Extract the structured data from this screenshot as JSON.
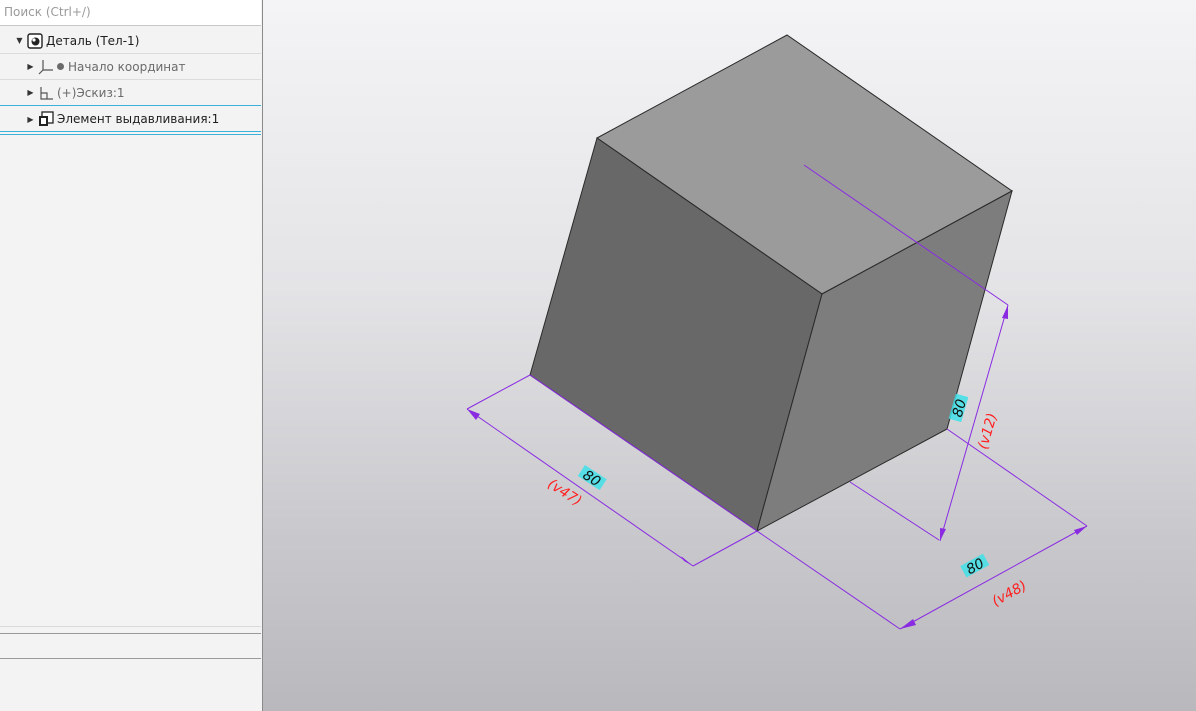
{
  "search": {
    "placeholder": "Поиск (Ctrl+/)"
  },
  "tree": {
    "root": {
      "label": "Деталь (Тел-1)"
    },
    "origin": {
      "label": "Начало координат"
    },
    "sketch": {
      "label": "(+)Эскиз:1"
    },
    "extrude": {
      "label": "Элемент выдавливания:1"
    }
  },
  "dimensions": {
    "width": {
      "value": "80",
      "variable": "(v47)"
    },
    "height": {
      "value": "80",
      "variable": "(v12)"
    },
    "depth": {
      "value": "80",
      "variable": "(v48)"
    }
  },
  "colors": {
    "dimension_line": "#8a2be2",
    "variable_text": "#ff2020",
    "value_box": "#40e0e8",
    "cube_top": "#9a9a9a",
    "cube_left": "#686868",
    "cube_right": "#7c7c7c"
  },
  "icons": {
    "expand": "triangle-right",
    "collapse": "triangle-down",
    "part": "part-icon",
    "origin": "axis-icon",
    "sketch": "sketch-icon",
    "extrude": "extrude-icon"
  }
}
